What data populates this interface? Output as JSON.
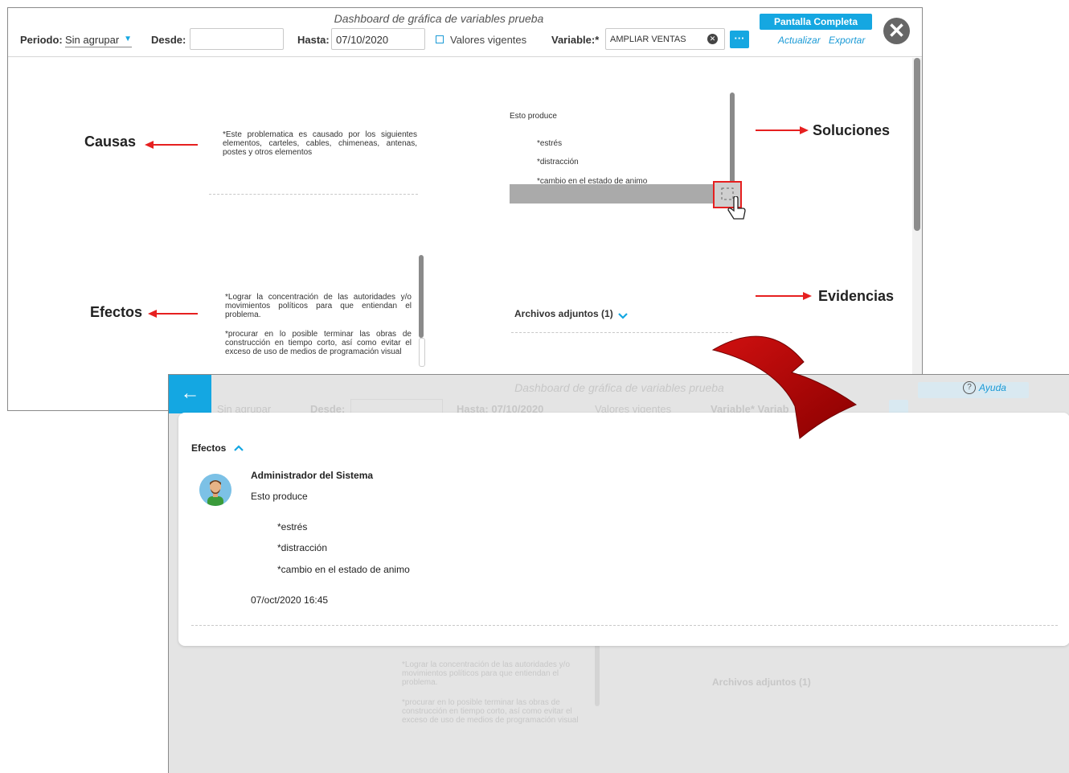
{
  "screenA": {
    "title": "Dashboard de gráfica de variables prueba",
    "periodo_label": "Periodo:",
    "periodo_value": "Sin agrupar",
    "desde_label": "Desde:",
    "hasta_label": "Hasta:",
    "hasta_value": "07/10/2020",
    "valores_label": "Valores vigentes",
    "variable_label": "Variable:*",
    "variable_value": "AMPLIAR VENTAS",
    "more_label": "···",
    "fullscreen_label": "Pantalla Completa",
    "actualizar_label": "Actualizar",
    "exportar_label": "Exportar",
    "close_glyph": "✕",
    "causas_label": "Causas",
    "causas_text": "*Este problematica es causado por los siguientes elementos, carteles, cables, chimeneas, antenas, postes y otros elementos",
    "soluciones_label": "Soluciones",
    "soluciones_intro": "Esto produce",
    "soluciones_items": [
      "*estrés",
      "*distracción",
      "*cambio en el estado de animo"
    ],
    "efectos_label": "Efectos",
    "efectos_p1": "*Lograr la concentración de las autoridades y/o movimientos políticos para que entiendan el problema.",
    "efectos_p2": "*procurar en lo posible terminar las obras de construcción en tiempo corto, así como evitar el exceso de uso de medios de programación visual",
    "evidencias_label": "Evidencias",
    "archivos_label": "Archivos adjuntos (1)"
  },
  "screenB": {
    "back_glyph": "←",
    "ghost_title": "Dashboard de gráfica de variables prueba",
    "ghost_periodo": "Sin agrupar",
    "ghost_desde": "Desde:",
    "ghost_hasta": "Hasta: 07/10/2020",
    "ghost_valores": "Valores vigentes",
    "ghost_variable": "Variable*  Variab",
    "ghost_efectos_p1": "*Lograr la concentración de las autoridades y/o movimientos políticos para que entiendan el problema.",
    "ghost_efectos_p2": "*procurar en lo posible terminar las obras de construcción en tiempo corto, así como evitar el exceso de uso de medios de programación visual",
    "ghost_archivos": "Archivos adjuntos (1)",
    "help_glyph": "?",
    "help_label": "Ayuda",
    "section_label": "Efectos",
    "author": "Administrador del Sistema",
    "intro": "Esto produce",
    "items": [
      "*estrés",
      "*distracción",
      "*cambio en el estado de animo"
    ],
    "timestamp": "07/oct/2020 16:45"
  }
}
